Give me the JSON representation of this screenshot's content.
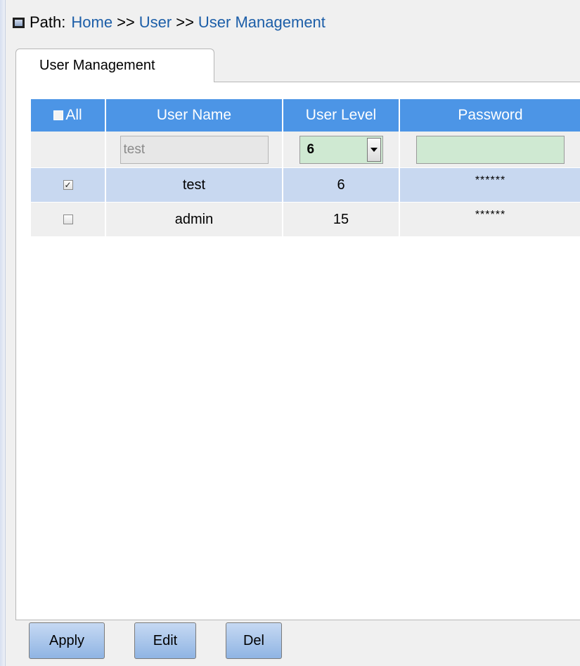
{
  "breadcrumb": {
    "label": "Path:",
    "items": [
      "Home",
      "User",
      "User Management"
    ],
    "separator": ">>"
  },
  "tab": {
    "label": "User Management"
  },
  "table": {
    "headers": {
      "all": "All",
      "user_name": "User Name",
      "user_level": "User Level",
      "password": "Password"
    },
    "edit_row": {
      "user_name_value": "test",
      "user_level_value": "6",
      "password_value": ""
    },
    "rows": [
      {
        "checked": true,
        "user_name": "test",
        "user_level": "6",
        "password": "******"
      },
      {
        "checked": false,
        "user_name": "admin",
        "user_level": "15",
        "password": "******"
      }
    ]
  },
  "buttons": {
    "apply": "Apply",
    "edit": "Edit",
    "del": "Del"
  },
  "colors": {
    "header_bg": "#4c95e6",
    "link": "#1c5ea8",
    "selected_row": "#c8d8f0",
    "edit_field": "#cfe9d2"
  }
}
